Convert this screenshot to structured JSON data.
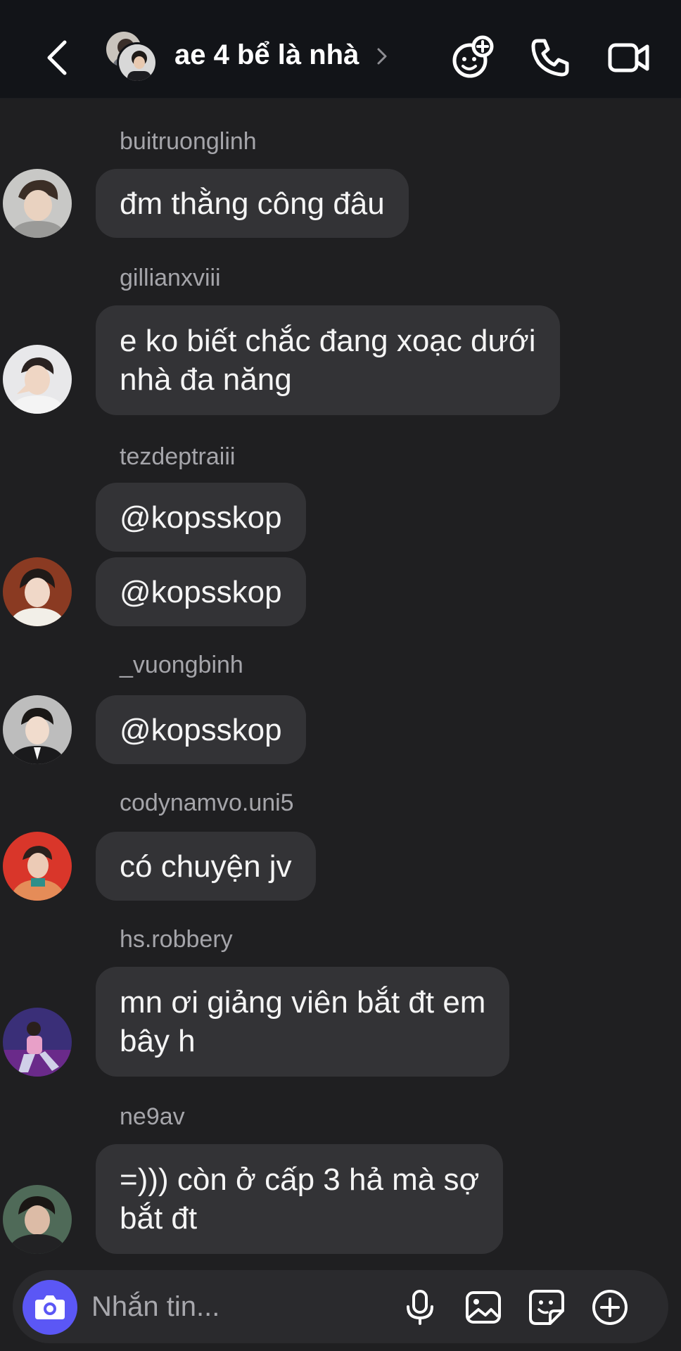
{
  "header": {
    "title": "ae 4 bể là nhà",
    "icons": [
      "back-chevron-icon",
      "group-avatar",
      "chevron-right-icon",
      "add-effect-icon",
      "phone-icon",
      "video-call-icon"
    ]
  },
  "messages": [
    {
      "sender": "buitruonglinh",
      "bubbles": [
        [
          "đm thằng công đâu"
        ]
      ]
    },
    {
      "sender": "gillianxviii",
      "bubbles": [
        [
          "e ko biết chắc đang xoạc dưới",
          "nhà đa năng"
        ]
      ]
    },
    {
      "sender": "tezdeptraiii",
      "bubbles": [
        [
          "@kopsskop"
        ],
        [
          "@kopsskop"
        ]
      ]
    },
    {
      "sender": "_vuongbinh",
      "bubbles": [
        [
          "@kopsskop"
        ]
      ]
    },
    {
      "sender": "codynamvo.uni5",
      "bubbles": [
        [
          "có chuyện jv"
        ]
      ]
    },
    {
      "sender": "hs.robbery",
      "bubbles": [
        [
          "mn ơi giảng viên bắt đt em",
          "bây h"
        ]
      ]
    },
    {
      "sender": "ne9av",
      "bubbles": [
        [
          "=))) còn ở cấp 3 hả mà sợ",
          "bắt đt"
        ]
      ]
    }
  ],
  "composer": {
    "placeholder": "Nhắn tin...",
    "icons": [
      "camera-icon",
      "microphone-icon",
      "gallery-icon",
      "sticker-icon",
      "plus-circle-icon"
    ]
  },
  "colors": {
    "background": "#1f1f21",
    "header": "#121418",
    "bubble": "#333336",
    "camera_button": "#5b57f5",
    "sender_text": "#a5a5aa"
  }
}
